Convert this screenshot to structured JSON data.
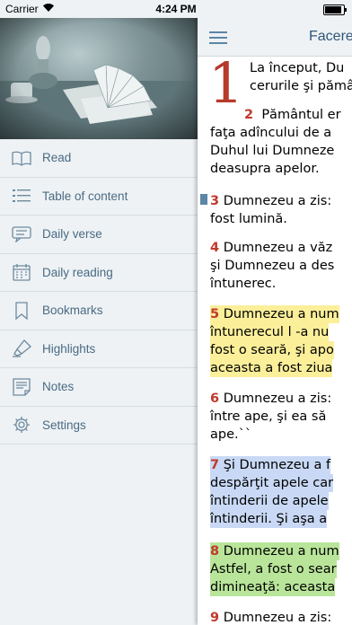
{
  "status": {
    "carrier": "Carrier",
    "time": "4:24 PM"
  },
  "sidebar": {
    "items": [
      {
        "label": "Read",
        "icon": "book-icon"
      },
      {
        "label": "Table of content",
        "icon": "list-icon"
      },
      {
        "label": "Daily verse",
        "icon": "chat-icon"
      },
      {
        "label": "Daily reading",
        "icon": "calendar-icon"
      },
      {
        "label": "Bookmarks",
        "icon": "bookmark-icon"
      },
      {
        "label": "Highlights",
        "icon": "highlighter-icon"
      },
      {
        "label": "Notes",
        "icon": "notes-icon"
      },
      {
        "label": "Settings",
        "icon": "gear-icon"
      }
    ]
  },
  "reader": {
    "title": "Facere",
    "chapter": "1",
    "verses": [
      {
        "num": "",
        "lines": [
          "La început, Du",
          "cerurile şi pămâ"
        ]
      },
      {
        "num": "2",
        "lines": [
          "Pământul er",
          "faţa adîncului de a",
          "Duhul lui Dumneze",
          "deasupra apelor."
        ]
      },
      {
        "num": "3",
        "lines": [
          "Dumnezeu a zis:",
          "fost lumină."
        ]
      },
      {
        "num": "4",
        "lines": [
          "Dumnezeu a văz",
          "şi Dumnezeu a des",
          "întunerec."
        ]
      },
      {
        "num": "5",
        "lines": [
          "Dumnezeu a num",
          "întunerecul l -a nu",
          "fost o seară, şi apo",
          "aceasta a fost ziua"
        ]
      },
      {
        "num": "6",
        "lines": [
          "Dumnezeu a zis:",
          "între ape, şi ea să",
          "ape.``"
        ]
      },
      {
        "num": "7",
        "lines": [
          "Şi Dumnezeu a f",
          "despărţit apele car",
          "întinderii de apele",
          "întinderii. Şi aşa a"
        ]
      },
      {
        "num": "8",
        "lines": [
          "Dumnezeu a num",
          "Astfel, a fost o sear",
          "dimineaţă: aceasta"
        ]
      },
      {
        "num": "9",
        "lines": [
          "Dumnezeu a zis:"
        ]
      }
    ],
    "colors": {
      "highlight_yellow": "#fbef9a",
      "highlight_blue": "#c9d9f5",
      "highlight_green": "#b9e59a",
      "verse_number": "#c0392b"
    }
  }
}
